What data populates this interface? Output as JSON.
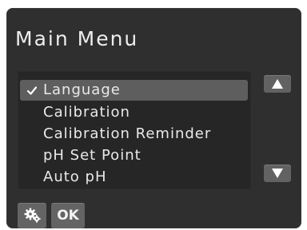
{
  "screen": {
    "title": "Main Menu"
  },
  "menu": {
    "items": [
      {
        "label": "Language",
        "selected": true
      },
      {
        "label": "Calibration",
        "selected": false
      },
      {
        "label": "Calibration Reminder",
        "selected": false
      },
      {
        "label": "pH Set Point",
        "selected": false
      },
      {
        "label": "Auto pH",
        "selected": false
      }
    ]
  },
  "controls": {
    "scroll_up_icon": "triangle-up-icon",
    "scroll_down_icon": "triangle-down-icon",
    "settings_icon": "gears-icon",
    "ok_label": "OK"
  },
  "colors": {
    "background": "#2f2f2f",
    "list_background": "#262626",
    "selection": "#5e5e5e",
    "button": "#646464",
    "text": "#ededed"
  }
}
